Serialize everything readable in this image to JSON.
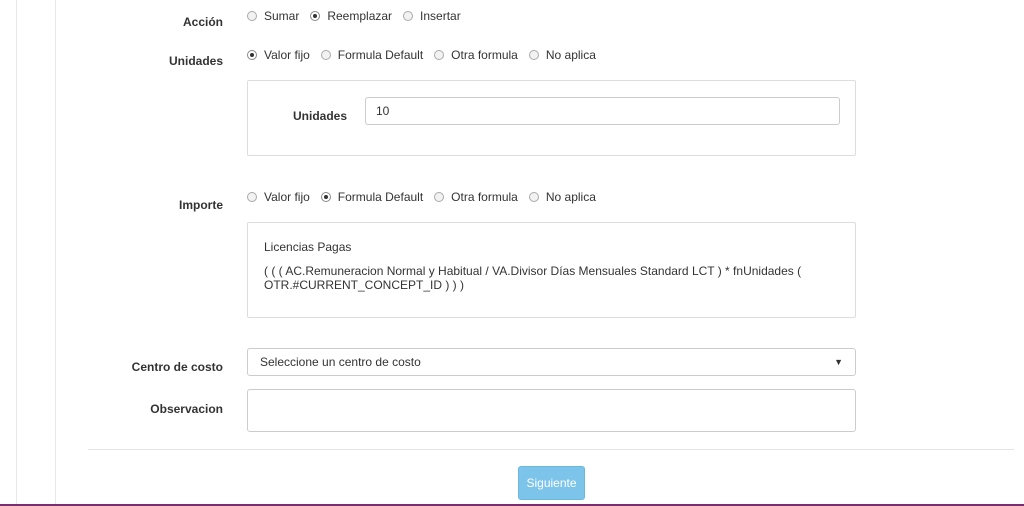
{
  "accion": {
    "label": "Acción",
    "options": [
      "Sumar",
      "Reemplazar",
      "Insertar"
    ],
    "selected": "Reemplazar"
  },
  "unidades": {
    "label": "Unidades",
    "options": [
      "Valor fijo",
      "Formula Default",
      "Otra formula",
      "No aplica"
    ],
    "selected": "Valor fijo",
    "panel": {
      "field_label": "Unidades",
      "field_value": "10"
    }
  },
  "importe": {
    "label": "Importe",
    "options": [
      "Valor fijo",
      "Formula Default",
      "Otra formula",
      "No aplica"
    ],
    "selected": "Formula Default",
    "panel": {
      "formula_name": "Licencias Pagas",
      "formula_text": "( ( ( AC.Remuneracion Normal y Habitual / VA.Divisor Días Mensuales Standard LCT ) * fnUnidades ( OTR.#CURRENT_CONCEPT_ID ) ) )"
    }
  },
  "centro_costo": {
    "label": "Centro de costo",
    "selected_text": "Seleccione un centro de costo",
    "arrow_icon": "caret-down-icon"
  },
  "observacion": {
    "label": "Observacion",
    "value": ""
  },
  "footer": {
    "next_label": "Siguiente"
  },
  "colors": {
    "button_bg": "#7cc4ea",
    "bottom_accent": "#7b2b6e"
  }
}
